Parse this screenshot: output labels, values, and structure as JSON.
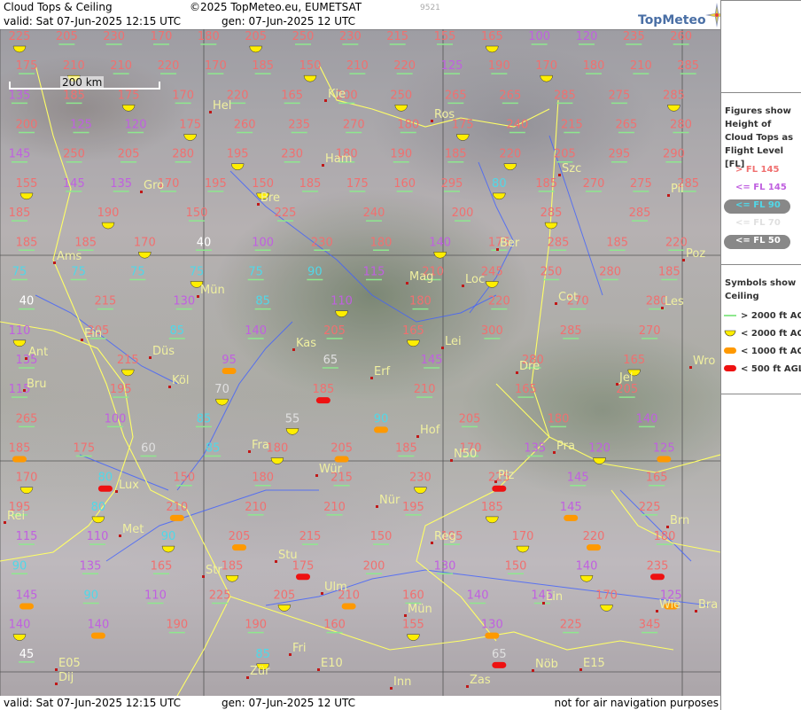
{
  "header": {
    "title": "Cloud Tops & Ceiling",
    "copyright": "©2025 TopMeteo.eu, EUMETSAT",
    "valid": "valid:  Sat  07-Jun-2025  12:15 UTC",
    "gen": "gen: 07-Jun-2025 12 UTC",
    "tiny": "9521",
    "brand": "TopMeteo"
  },
  "footer": {
    "valid": "valid:  Sat  07-Jun-2025  12:15 UTC",
    "gen": "gen: 07-Jun-2025 12 UTC",
    "note": "not for air navigation purposes"
  },
  "scale_label": "200 km",
  "legend": {
    "title": "Figures show Height of Cloud Tops as Flight Level  [FL]",
    "levels": [
      {
        "label": "> FL 145",
        "color": "#f07070",
        "pill": false
      },
      {
        "label": "<= FL 145",
        "color": "#c060e0",
        "pill": false
      },
      {
        "label": "<= FL 90",
        "color": "#50d8e8",
        "pill": true
      },
      {
        "label": "<= FL 70",
        "color": "#e0e0e0",
        "pill": false
      },
      {
        "label": "<= FL 50",
        "color": "#ffffff",
        "pill": true
      }
    ],
    "symbols_title": "Symbols show Ceiling",
    "symbols": [
      {
        "label": "> 2000 ft AGL",
        "kind": "line",
        "color": "#8ee88e"
      },
      {
        "label": "< 2000 ft AGL",
        "kind": "half",
        "color": "#ffee00"
      },
      {
        "label": "< 1000 ft AGL",
        "kind": "bar",
        "color": "#ff9900"
      },
      {
        "label": "< 500 ft AGL",
        "kind": "bar",
        "color": "#ee1111"
      }
    ]
  },
  "colors": {
    "high": "#f07070",
    "mid": "#c060e0",
    "low": "#50d8e8",
    "vlow": "#e0e0e0",
    "lowest": "#ffffff",
    "city": "#f0f0a0",
    "border": "#ffff66",
    "river": "#4060ff"
  },
  "cities": [
    "Kie",
    "Hel",
    "Ros",
    "Ham",
    "Gro",
    "Bre",
    "Szc",
    "Pil",
    "Ber",
    "Ams",
    "Poz",
    "Mag",
    "Loc",
    "Mün",
    "Cot",
    "Les",
    "Ein",
    "Kas",
    "Lei",
    "Ant",
    "Düs",
    "Wro",
    "Bru",
    "Köl",
    "Erf",
    "Dre",
    "Jel",
    "Hof",
    "Fra",
    "Pra",
    "Lux",
    "Wür",
    "Plz",
    "N50",
    "Nür",
    "Rei",
    "Met",
    "Brn",
    "Reg",
    "Stu",
    "Str",
    "Ulm",
    "Lin",
    "Mün",
    "Wie",
    "Bra",
    "Fri",
    "Zür",
    "Inn",
    "Zas",
    "Nöb",
    "Dij",
    "E05",
    "E10",
    "E15"
  ],
  "values": [
    [
      "225",
      "205",
      "230",
      "170",
      "180",
      "205",
      "250",
      "230",
      "215",
      "155",
      "165",
      "100",
      "120",
      "235",
      "260"
    ],
    [
      "175",
      "210",
      "210",
      "220",
      "170",
      "185",
      "150",
      "210",
      "220",
      "125",
      "190",
      "170",
      "180",
      "210",
      "285"
    ],
    [
      "135",
      "185",
      "175",
      "170",
      "220",
      "165",
      "200",
      "250",
      "265",
      "265",
      "285",
      "275",
      "285"
    ],
    [
      "200",
      "125",
      "120",
      "175",
      "260",
      "235",
      "270",
      "180",
      "175",
      "240",
      "215",
      "265",
      "280"
    ],
    [
      "145",
      "250",
      "205",
      "280",
      "195",
      "230",
      "180",
      "190",
      "185",
      "220",
      "205",
      "295",
      "290"
    ],
    [
      "155",
      "145",
      "135",
      "170",
      "195",
      "150",
      "185",
      "175",
      "160",
      "295",
      "80",
      "185",
      "270",
      "275",
      "285"
    ],
    [
      "185",
      "190",
      "150",
      "225",
      "240",
      "200",
      "285",
      "285"
    ],
    [
      "185",
      "185",
      "170",
      "40",
      "100",
      "230",
      "180",
      "140",
      "175",
      "285",
      "185",
      "220"
    ],
    [
      "75",
      "75",
      "75",
      "75",
      "75",
      "90",
      "115",
      "210",
      "245",
      "250",
      "280",
      "185"
    ],
    [
      "40",
      "215",
      "130",
      "85",
      "110",
      "180",
      "220",
      "270",
      "280"
    ],
    [
      "110",
      "205",
      "85",
      "140",
      "205",
      "165",
      "300",
      "285",
      "270"
    ],
    [
      "135",
      "215",
      "95",
      "65",
      "145",
      "280",
      "165"
    ],
    [
      "115",
      "195",
      "70",
      "185",
      "210",
      "165",
      "205"
    ],
    [
      "265",
      "100",
      "85",
      "55",
      "90",
      "205",
      "180",
      "140"
    ],
    [
      "185",
      "175",
      "60",
      "85",
      "180",
      "205",
      "185",
      "170",
      "135",
      "120",
      "125"
    ],
    [
      "170",
      "80",
      "150",
      "180",
      "215",
      "230",
      "225",
      "145",
      "165"
    ],
    [
      "195",
      "80",
      "210",
      "210",
      "210",
      "195",
      "185",
      "145",
      "225"
    ],
    [
      "115",
      "110",
      "90",
      "205",
      "215",
      "150",
      "195",
      "170",
      "220",
      "180"
    ],
    [
      "90",
      "135",
      "165",
      "185",
      "175",
      "200",
      "130",
      "150",
      "140",
      "235"
    ],
    [
      "145",
      "90",
      "110",
      "225",
      "205",
      "210",
      "160",
      "140",
      "145",
      "170",
      "125"
    ],
    [
      "140",
      "140",
      "190",
      "190",
      "160",
      "155",
      "130",
      "225",
      "345"
    ],
    [
      "45",
      "85",
      "65"
    ]
  ]
}
